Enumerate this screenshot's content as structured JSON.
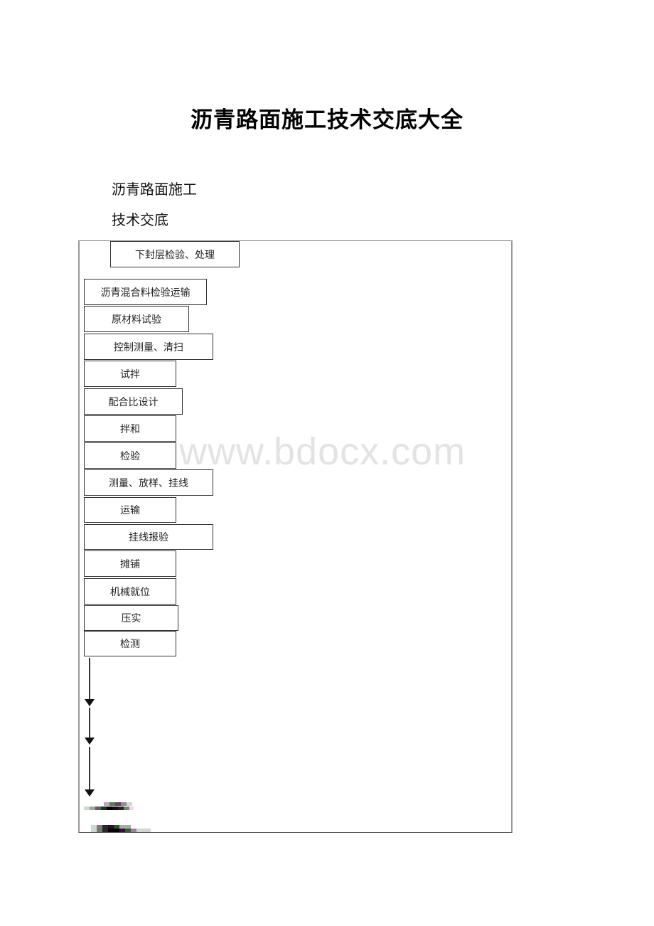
{
  "document": {
    "title": "沥青路面施工技术交底大全",
    "subtitle_line1": "沥青路面施工",
    "subtitle_line2": "技术交底"
  },
  "flowchart": {
    "steps": [
      {
        "label": "下封层检验、处理"
      },
      {
        "label": "沥青混合料检验运输"
      },
      {
        "label": "原材料试验"
      },
      {
        "label": "控制测量、清扫"
      },
      {
        "label": "试拌"
      },
      {
        "label": "配合比设计"
      },
      {
        "label": "拌和"
      },
      {
        "label": "检验"
      },
      {
        "label": "测量、放样、挂线"
      },
      {
        "label": "运输"
      },
      {
        "label": "挂线报验"
      },
      {
        "label": "摊铺"
      },
      {
        "label": "机械就位"
      },
      {
        "label": "压实"
      },
      {
        "label": "检测"
      }
    ],
    "arrow_count": 3
  },
  "watermark": {
    "text": "www.bdocx.com"
  }
}
